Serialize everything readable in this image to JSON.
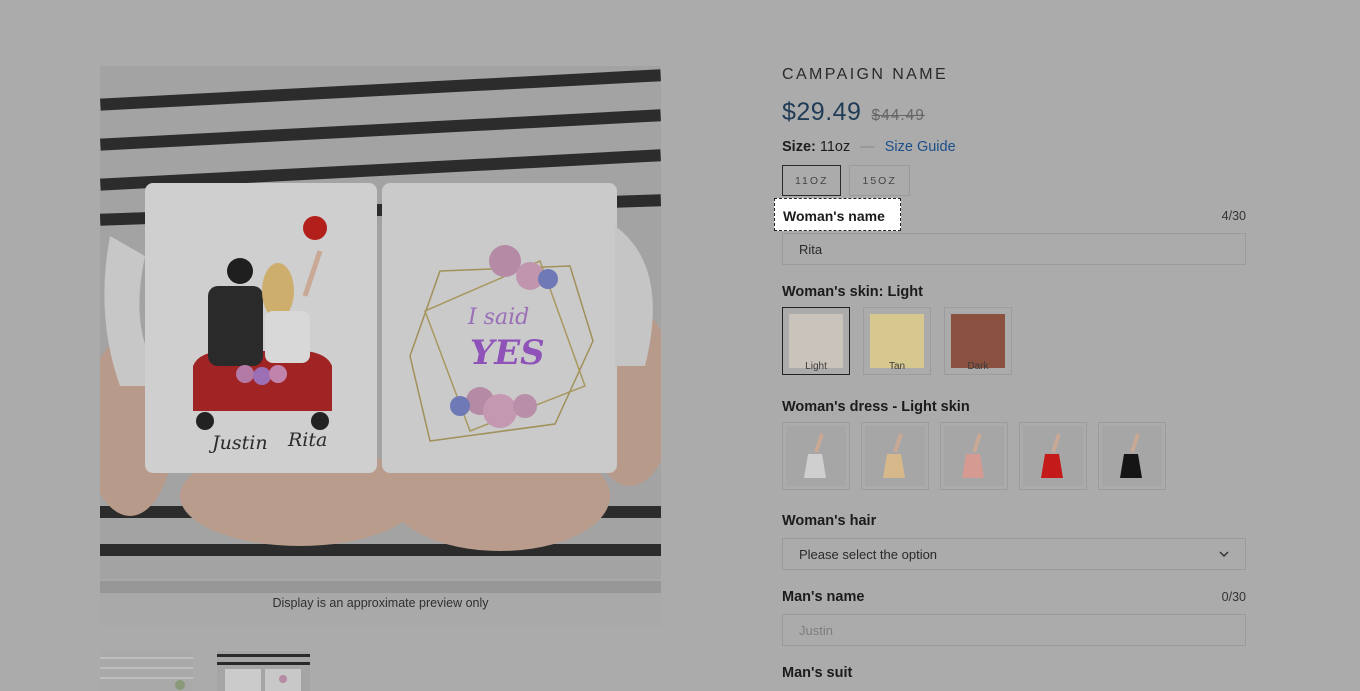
{
  "product": {
    "title": "CAMPAIGN NAME",
    "price": "$29.49",
    "compare_price": "$44.49",
    "size_label": "Size:",
    "size_value": "11oz",
    "size_separator": "—",
    "size_guide": "Size Guide",
    "sizes": [
      {
        "label": "11OZ",
        "selected": true
      },
      {
        "label": "15OZ",
        "selected": false
      }
    ]
  },
  "preview": {
    "note": "Display is an approximate preview only",
    "mug_left_names": [
      "Justin",
      "Rita"
    ],
    "mug_right_text": [
      "I said",
      "YES"
    ]
  },
  "fields": {
    "womans_name": {
      "label": "Woman's name",
      "value": "Rita",
      "counter": "4/30"
    },
    "womans_skin": {
      "label": "Woman's skin: Light",
      "options": [
        {
          "label": "Light",
          "color": "#c9c3bb",
          "selected": true
        },
        {
          "label": "Tan",
          "color": "#d9c98f",
          "selected": false
        },
        {
          "label": "Dark",
          "color": "#8a5141",
          "selected": false
        }
      ]
    },
    "womans_dress": {
      "label": "Woman's dress - Light skin",
      "options": [
        {
          "name": "white-dress",
          "color": "#c8c8c8"
        },
        {
          "name": "champagne-dress",
          "color": "#d9b98a"
        },
        {
          "name": "pink-dress",
          "color": "#d79a92"
        },
        {
          "name": "red-dress",
          "color": "#c51a1a"
        },
        {
          "name": "black-dress",
          "color": "#151515"
        }
      ]
    },
    "womans_hair": {
      "label": "Woman's hair",
      "value": "Please select the option"
    },
    "mans_name": {
      "label": "Man's name",
      "placeholder": "Justin",
      "counter": "0/30"
    },
    "mans_suit": {
      "label": "Man's suit"
    }
  },
  "colors": {
    "overlay": "#ababab",
    "price": "#1f3b56",
    "link": "#1c4f8a"
  }
}
